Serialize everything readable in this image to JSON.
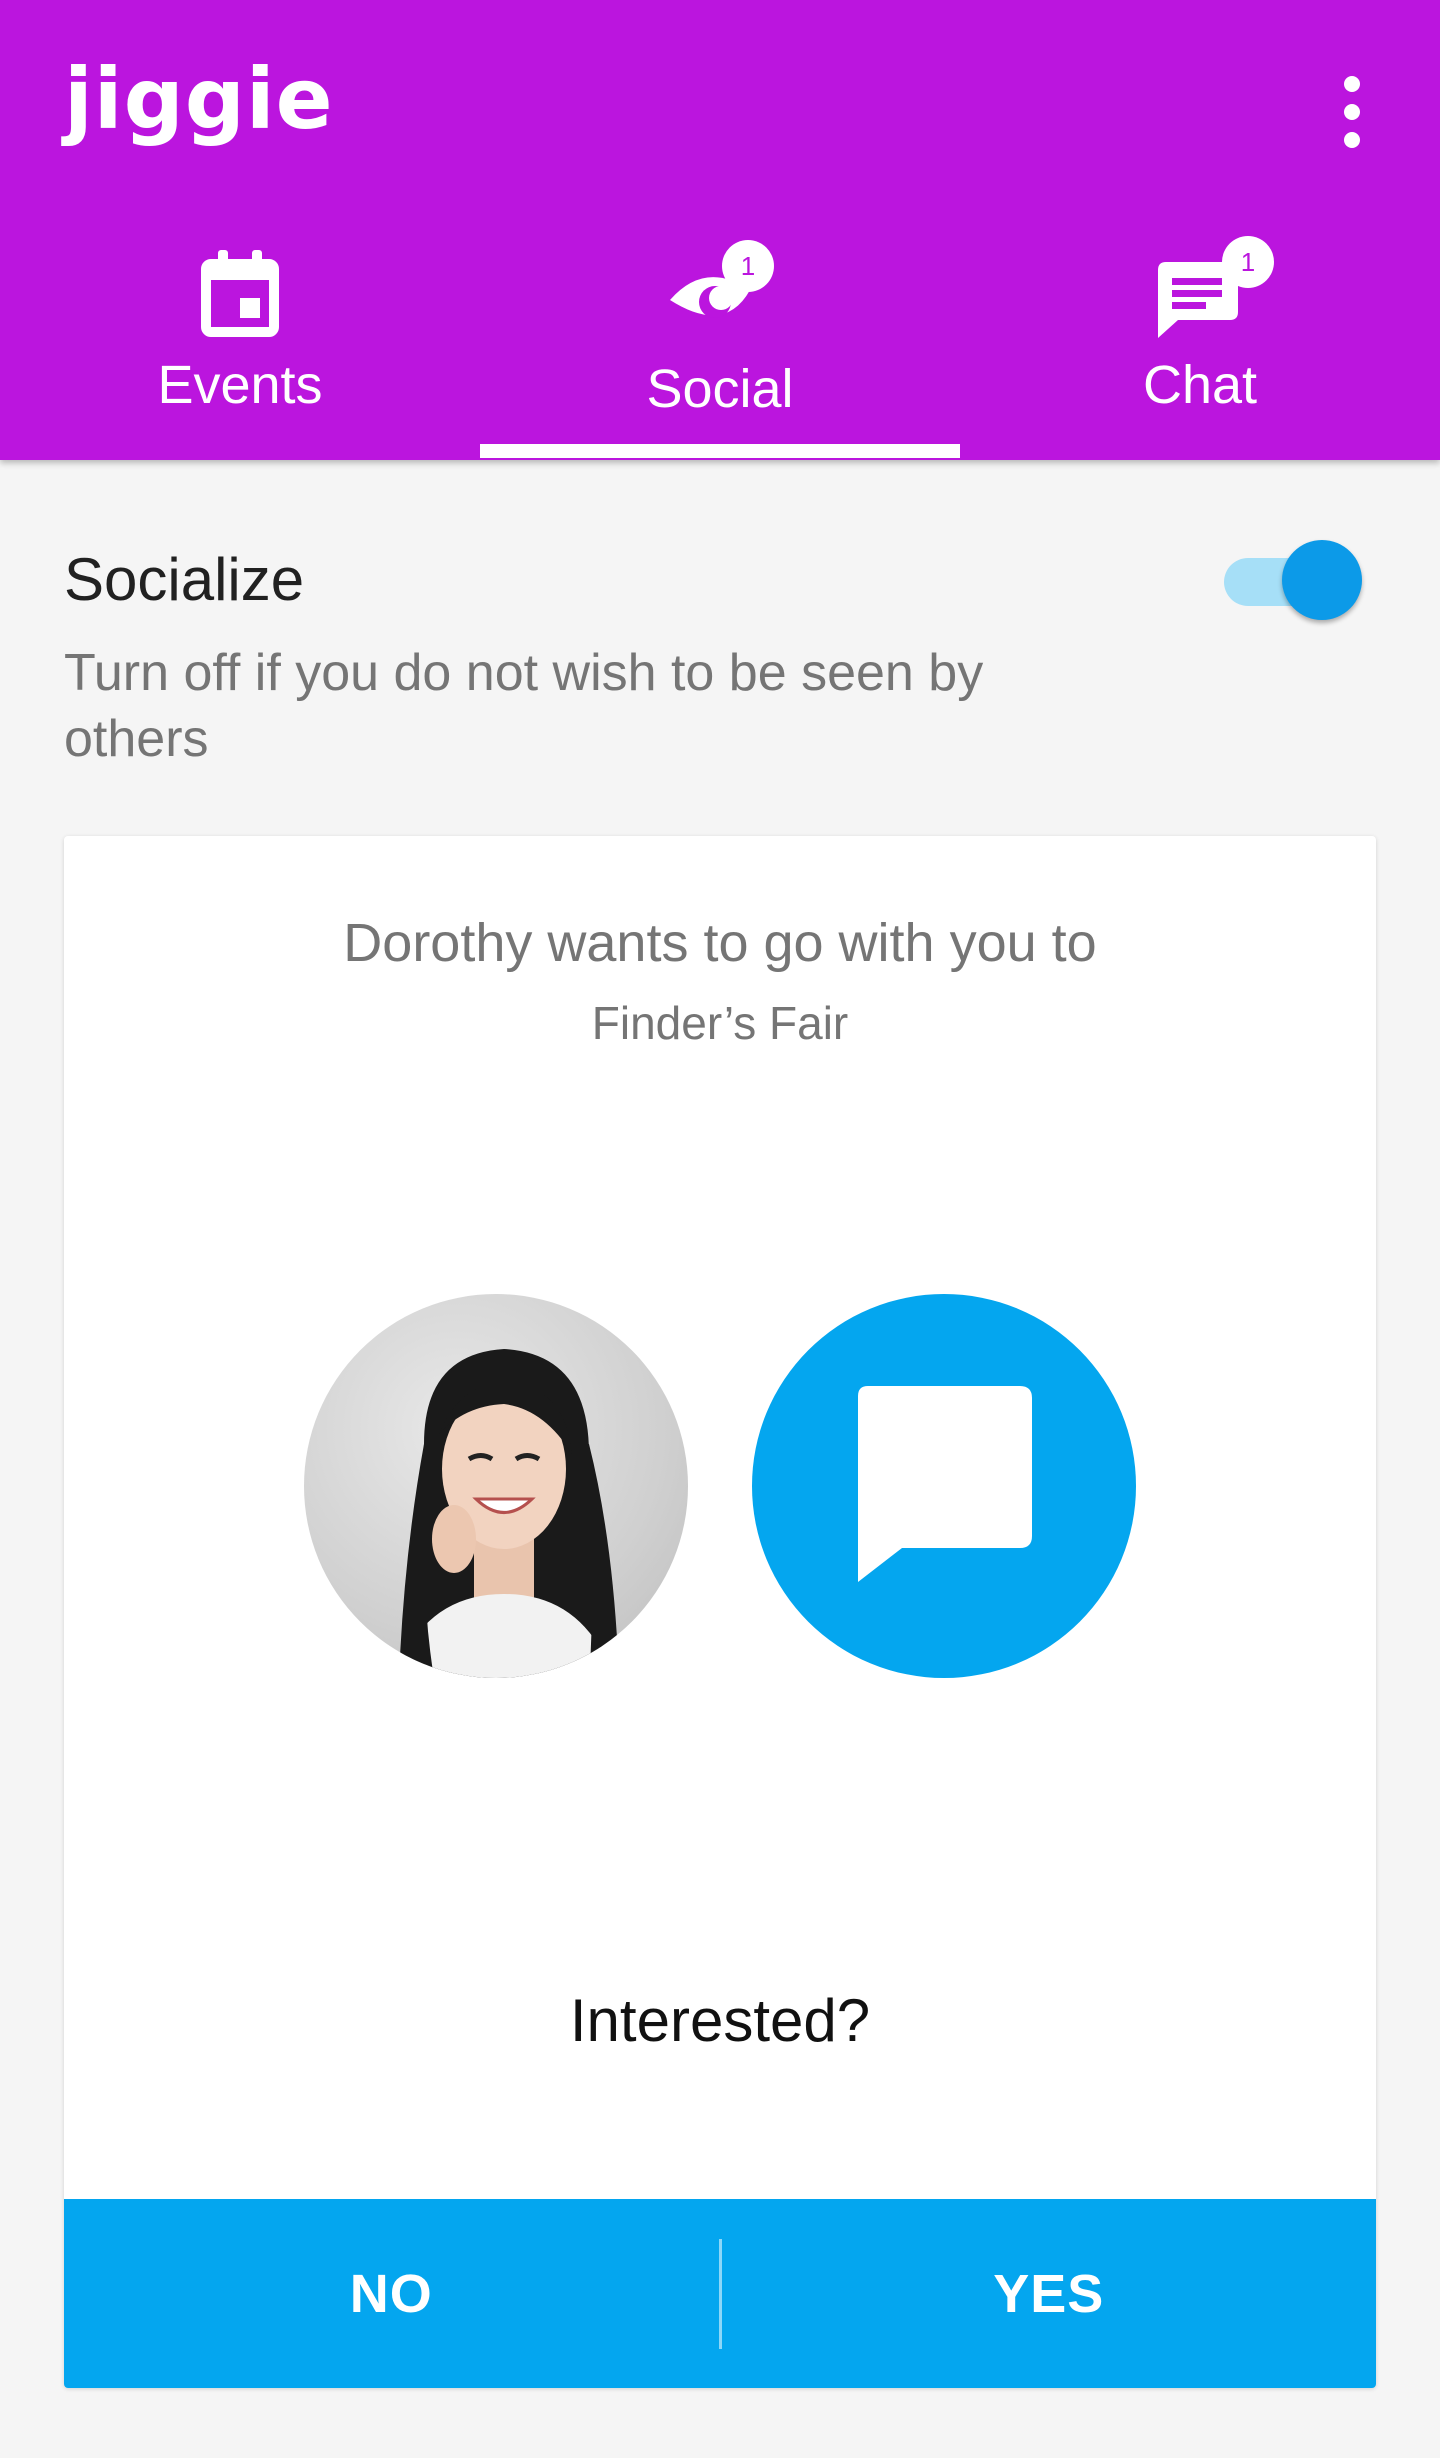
{
  "app": {
    "name": "jiggie",
    "brand_color": "#bb15de",
    "accent_color": "#04a6ef"
  },
  "header": {
    "menu_icon": "more-vert-icon",
    "tabs": [
      {
        "label": "Events",
        "icon": "calendar-icon",
        "badge": "",
        "active": false
      },
      {
        "label": "Social",
        "icon": "social-eye-icon",
        "badge": "1",
        "active": true
      },
      {
        "label": "Chat",
        "icon": "chat-bubble-icon",
        "badge": "1",
        "active": false
      }
    ]
  },
  "socialize": {
    "title": "Socialize",
    "description": "Turn off if you do not wish to be seen by others",
    "toggle_on": true
  },
  "card": {
    "line1": "Dorothy wants to go with you to",
    "line2": "Finder’s Fair",
    "question": "Interested?",
    "no_label": "NO",
    "yes_label": "YES"
  }
}
